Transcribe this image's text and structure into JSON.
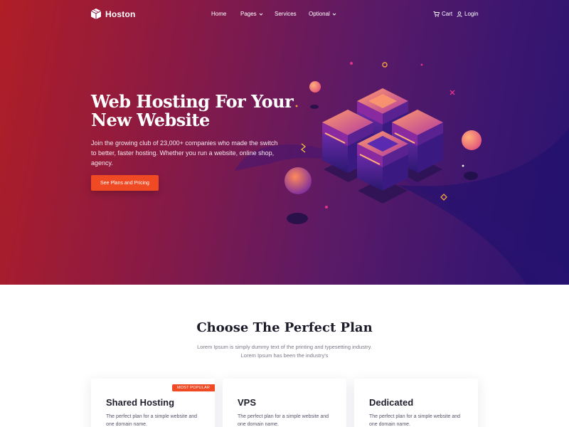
{
  "brand": {
    "name": "Hoston"
  },
  "nav": {
    "items": [
      {
        "label": "Home",
        "has_dropdown": false
      },
      {
        "label": "Pages",
        "has_dropdown": true
      },
      {
        "label": "Services",
        "has_dropdown": false
      },
      {
        "label": "Optional",
        "has_dropdown": true
      }
    ],
    "cart_label": "Cart",
    "login_label": "Login"
  },
  "hero": {
    "title_line1": "Web Hosting For Your",
    "title_line2": "New Website",
    "subtitle": "Join the growing club of 23,000+ companies who made the switch to better, faster hosting. Whether you run a website, online shop, agency.",
    "cta_label": "See Plans and Pricing"
  },
  "plans_section": {
    "title": "Choose The Perfect Plan",
    "subtitle_line1": "Lorem Ipsum is simply dummy text of the printing and typesetting industry.",
    "subtitle_line2": "Lorem Ipsum has been the industry's"
  },
  "plans": [
    {
      "name": "Shared Hosting",
      "description": "The perfect plan for a simple website and one domain name.",
      "badge": "MOST POPULAR"
    },
    {
      "name": "VPS",
      "description": "The perfect plan for a simple website and one domain name.",
      "badge": ""
    },
    {
      "name": "Dedicated",
      "description": "The perfect plan for a simple website and one domain name.",
      "badge": ""
    }
  ],
  "colors": {
    "accent": "#f04a24",
    "hero_gradient_start": "#b01e26",
    "hero_gradient_end": "#2a1470",
    "heading": "#1b1b2a"
  }
}
